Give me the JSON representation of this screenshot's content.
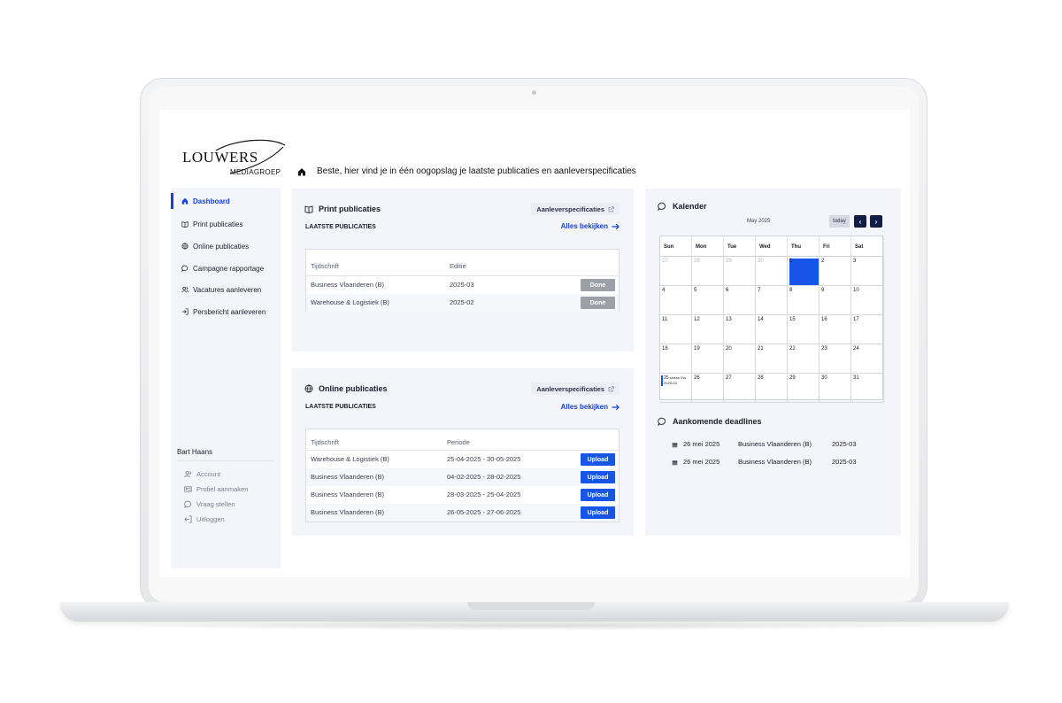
{
  "header": {
    "logo_primary": "LOUWERS",
    "logo_secondary": "MEDIAGROEP",
    "greeting": "Beste, hier vind je in één oogopslag je laatste publicaties en aanleverspecificaties"
  },
  "sidebar": {
    "items": [
      {
        "label": "Dashboard",
        "icon": "home-icon"
      },
      {
        "label": "Print publicaties",
        "icon": "book-icon"
      },
      {
        "label": "Online publicaties",
        "icon": "globe-icon"
      },
      {
        "label": "Campagne rapportage",
        "icon": "chat-icon"
      },
      {
        "label": "Vacatures aanleveren",
        "icon": "users-icon"
      },
      {
        "label": "Persbericht aanleveren",
        "icon": "login-icon"
      }
    ],
    "user_name": "Bart Haans",
    "user_links": [
      {
        "label": "Account",
        "icon": "users-icon"
      },
      {
        "label": "Profiel aanmaken",
        "icon": "id-card-icon"
      },
      {
        "label": "Vraag stellen",
        "icon": "chat-icon"
      },
      {
        "label": "Uitloggen",
        "icon": "logout-icon"
      }
    ]
  },
  "print": {
    "title": "Print publicaties",
    "spec_label": "Aanleverspecificaties",
    "latest_label": "LAATSTE PUBLICATIES",
    "see_all": "Alles bekijken",
    "columns": [
      "Tijdschrift",
      "Editie"
    ],
    "rows": [
      {
        "title": "Business Vlaanderen (B)",
        "value": "2025-03",
        "action": "Done"
      },
      {
        "title": "Warehouse & Logistiek (B)",
        "value": "2025-02",
        "action": "Done"
      }
    ]
  },
  "online": {
    "title": "Online publicaties",
    "spec_label": "Aanleverspecificaties",
    "latest_label": "LAATSTE PUBLICATIES",
    "see_all": "Alles bekijken",
    "columns": [
      "Tijdschrift",
      "Periode"
    ],
    "rows": [
      {
        "title": "Warehouse & Logistiek (B)",
        "value": "25-04-2025 - 30-05-2025",
        "action": "Upload"
      },
      {
        "title": "Business Vlaanderen (B)",
        "value": "04-02-2025 - 28-02-2025",
        "action": "Upload"
      },
      {
        "title": "Business Vlaanderen (B)",
        "value": "28-03-2025 - 25-04-2025",
        "action": "Upload"
      },
      {
        "title": "Business Vlaanderen (B)",
        "value": "26-05-2025 - 27-06-2025",
        "action": "Upload"
      }
    ]
  },
  "calendar": {
    "title": "Kalender",
    "month": "May 2025",
    "today_label": "today",
    "prev_label": "‹",
    "next_label": "›",
    "weekdays": [
      "Sun",
      "Mon",
      "Tue",
      "Wed",
      "Thu",
      "Fri",
      "Sat"
    ],
    "weeks": [
      [
        {
          "d": "27",
          "muted": true
        },
        {
          "d": "28",
          "muted": true
        },
        {
          "d": "29",
          "muted": true
        },
        {
          "d": "30",
          "muted": true
        },
        {
          "d": "1",
          "selected": true
        },
        {
          "d": "2"
        },
        {
          "d": "3"
        }
      ],
      [
        {
          "d": "4"
        },
        {
          "d": "5"
        },
        {
          "d": "6"
        },
        {
          "d": "7"
        },
        {
          "d": "8"
        },
        {
          "d": "9"
        },
        {
          "d": "10"
        }
      ],
      [
        {
          "d": "11"
        },
        {
          "d": "12"
        },
        {
          "d": "13"
        },
        {
          "d": "14"
        },
        {
          "d": "15"
        },
        {
          "d": "16"
        },
        {
          "d": "17"
        }
      ],
      [
        {
          "d": "18"
        },
        {
          "d": "19"
        },
        {
          "d": "20"
        },
        {
          "d": "21"
        },
        {
          "d": "22"
        },
        {
          "d": "23"
        },
        {
          "d": "24"
        }
      ],
      [
        {
          "d": "25",
          "event": "siness Vla",
          "event_sub": "2025-03"
        },
        {
          "d": "26"
        },
        {
          "d": "27"
        },
        {
          "d": "28"
        },
        {
          "d": "29"
        },
        {
          "d": "30"
        },
        {
          "d": "31"
        }
      ]
    ],
    "accent": "#1655e8"
  },
  "deadlines": {
    "title": "Aankomende deadlines",
    "rows": [
      {
        "date": "26 mei 2025",
        "title": "Business Vlaanderen (B)",
        "edition": "2025-03"
      },
      {
        "date": "26 mei 2025",
        "title": "Business Vlaanderen (B)",
        "edition": "2025-03"
      }
    ]
  },
  "colors": {
    "primary": "#1640d8",
    "upload": "#1655e8",
    "done": "#9ea0a8",
    "panel": "#f4f5fa",
    "nav_dark": "#101d47"
  }
}
